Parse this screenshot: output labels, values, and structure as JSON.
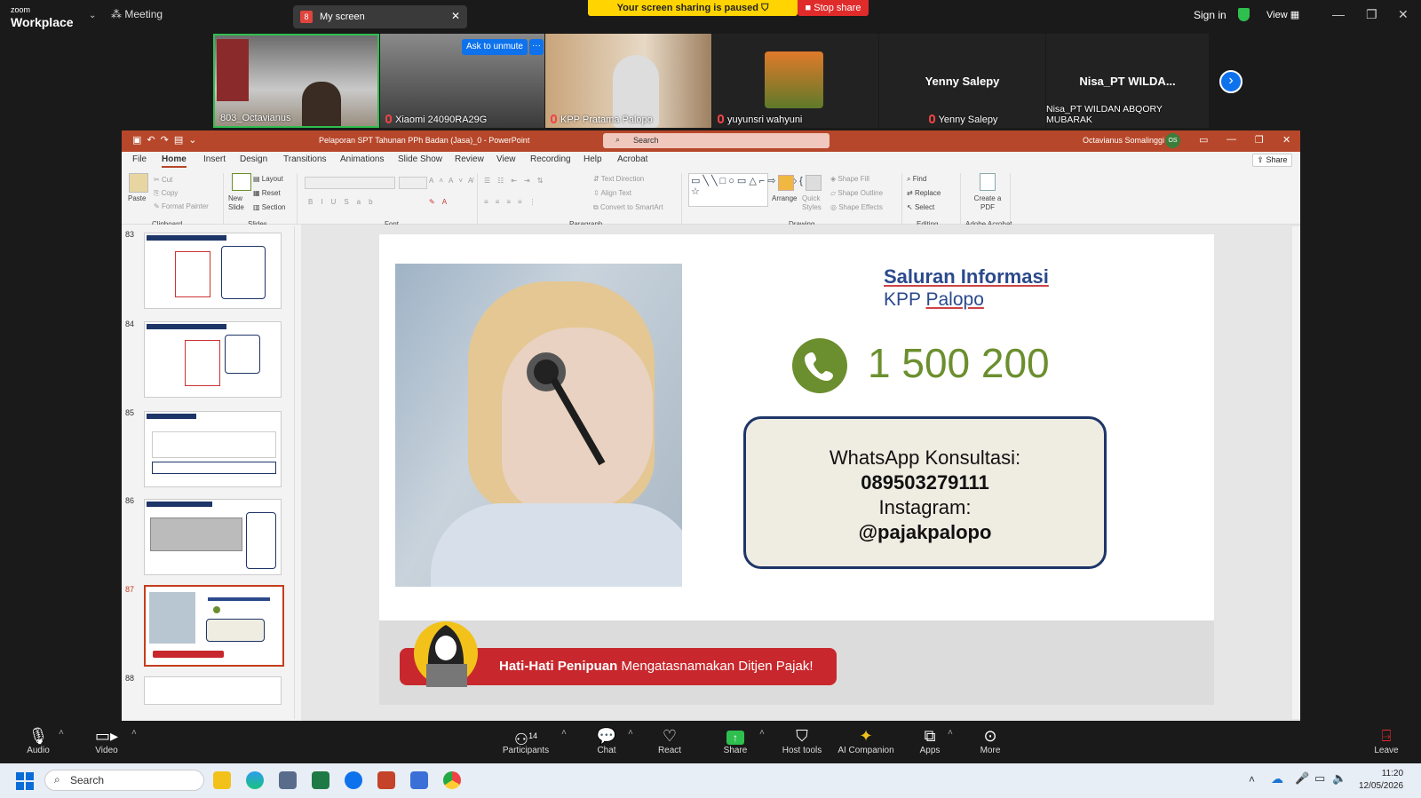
{
  "zoom": {
    "brand_top": "zoom",
    "brand_bottom": "Workplace",
    "meeting_label": "Meeting",
    "tab_badge": "8",
    "tab_label": "My screen",
    "pause_text": "Your screen sharing is paused",
    "stop_share": "Stop share",
    "sign_in": "Sign in",
    "view": "View"
  },
  "participants": [
    {
      "name": "803_Octavianus"
    },
    {
      "name": "Xiaomi 24090RA29G"
    },
    {
      "name": "KPP Pratama Palopo"
    },
    {
      "name": "yuyunsri wahyuni"
    },
    {
      "name": "Yenny Salepy",
      "center": "Yenny Salepy"
    },
    {
      "name": "Nisa_PT WILDAN ABQORY MUBARAK",
      "center": "Nisa_PT  WILDA..."
    }
  ],
  "ask_unmute": "Ask to unmute",
  "ppt": {
    "title": "Pelaporan SPT Tahunan PPh Badan (Jasa)_0  -  PowerPoint",
    "search": "Search",
    "user": "Octavianus Somalinggi",
    "user_initials": "OS",
    "share": "Share",
    "menus": [
      "File",
      "Home",
      "Insert",
      "Design",
      "Transitions",
      "Animations",
      "Slide Show",
      "Review",
      "View",
      "Recording",
      "Help",
      "Acrobat"
    ],
    "ribbon": {
      "paste": "Paste",
      "cut": "Cut",
      "copy": "Copy",
      "format_painter": "Format Painter",
      "new_slide": "New Slide",
      "layout": "Layout",
      "reset": "Reset",
      "section": "Section",
      "text_direction": "Text Direction",
      "align_text": "Align Text",
      "convert_smartart": "Convert to SmartArt",
      "arrange": "Arrange",
      "quick_styles": "Quick Styles",
      "shape_fill": "Shape Fill",
      "shape_outline": "Shape Outline",
      "shape_effects": "Shape Effects",
      "find": "Find",
      "replace": "Replace",
      "select": "Select",
      "create_pdf": "Create a PDF",
      "groups": [
        "Clipboard",
        "Slides",
        "Font",
        "Paragraph",
        "Drawing",
        "Editing",
        "Adobe Acrobat"
      ]
    },
    "thumbnails": [
      "83",
      "84",
      "85",
      "86",
      "87",
      "88"
    ],
    "slide": {
      "title": "Saluran Informasi",
      "subtitle_a": "KPP ",
      "subtitle_b": "Palopo",
      "phone": "1 500 200",
      "wa_label": "WhatsApp Konsultasi:",
      "wa_number": "089503279111",
      "ig_label": "Instagram:",
      "ig_handle": "@pajakpalopo",
      "banner_bold": "Hati-Hati Penipuan",
      "banner_rest": " Mengatasnamakan Ditjen Pajak!"
    }
  },
  "bottombar": {
    "audio": "Audio",
    "video": "Video",
    "participants": "Participants",
    "participants_count": "14",
    "chat": "Chat",
    "react": "React",
    "share": "Share",
    "host_tools": "Host tools",
    "ai": "AI Companion",
    "apps": "Apps",
    "more": "More",
    "leave": "Leave"
  },
  "taskbar": {
    "search": "Search",
    "time": "11:20",
    "date": "12/05/2026"
  },
  "colors": {
    "accent": "#0e72ed",
    "ppt": "#b7472a",
    "stop": "#e02b2b",
    "pause": "#ffd400"
  }
}
